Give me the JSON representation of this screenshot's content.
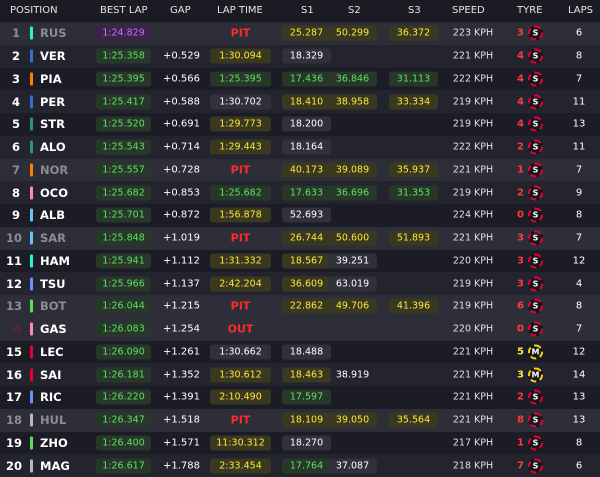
{
  "headers": {
    "position": "POSITION",
    "best_lap": "BEST LAP",
    "gap": "GAP",
    "lap_time": "LAP TIME",
    "s1": "S1",
    "s2": "S2",
    "s3": "S3",
    "speed": "SPEED",
    "tyre": "TYRE",
    "laps": "LAPS"
  },
  "colors": {
    "personal_best_green": "#5ee05e",
    "fastest_purple": "#c96cff",
    "improved_yellow": "#ffe63c",
    "pit_red": "#ff2a2a",
    "soft_tyre": "#e8002d",
    "medium_tyre": "#ffd200"
  },
  "rows": [
    {
      "pos": "1",
      "driver": "RUS",
      "team_color": "#27f4d2",
      "best": "1:24.829",
      "best_style": "fast",
      "gap": "",
      "lap": "PIT",
      "lap_style": "pit",
      "s1": "25.287",
      "s1_style": "yellow",
      "s2": "50.299",
      "s2_style": "yellow",
      "s3": "36.372",
      "s3_style": "yellow",
      "speed": "223 KPH",
      "tyre_age": "3",
      "tyre": "S",
      "tyre_type": "soft",
      "laps": "6",
      "dim": true
    },
    {
      "pos": "2",
      "driver": "VER",
      "team_color": "#3671c6",
      "best": "1:25.358",
      "best_style": "green",
      "gap": "+0.529",
      "lap": "1:30.094",
      "lap_style": "pb",
      "s1": "18.329",
      "s1_style": "white",
      "s2": "",
      "s2_style": "blank",
      "s3": "",
      "s3_style": "blank",
      "speed": "221 KPH",
      "tyre_age": "4",
      "tyre": "S",
      "tyre_type": "soft",
      "laps": "8",
      "dim": false
    },
    {
      "pos": "3",
      "driver": "PIA",
      "team_color": "#ff8000",
      "best": "1:25.395",
      "best_style": "green",
      "gap": "+0.566",
      "lap": "1:25.395",
      "lap_style": "green",
      "s1": "17.436",
      "s1_style": "green",
      "s2": "36.846",
      "s2_style": "green",
      "s3": "31.113",
      "s3_style": "green",
      "speed": "222 KPH",
      "tyre_age": "4",
      "tyre": "S",
      "tyre_type": "soft",
      "laps": "7",
      "dim": false
    },
    {
      "pos": "4",
      "driver": "PER",
      "team_color": "#3671c6",
      "best": "1:25.417",
      "best_style": "green",
      "gap": "+0.588",
      "lap": "1:30.702",
      "lap_style": "white",
      "s1": "18.410",
      "s1_style": "yellow",
      "s2": "38.958",
      "s2_style": "yellow",
      "s3": "33.334",
      "s3_style": "yellow",
      "speed": "219 KPH",
      "tyre_age": "4",
      "tyre": "S",
      "tyre_type": "soft",
      "laps": "11",
      "dim": false
    },
    {
      "pos": "5",
      "driver": "STR",
      "team_color": "#229971",
      "best": "1:25.520",
      "best_style": "green",
      "gap": "+0.691",
      "lap": "1:29.773",
      "lap_style": "pb",
      "s1": "18.200",
      "s1_style": "white",
      "s2": "",
      "s2_style": "blank",
      "s3": "",
      "s3_style": "blank",
      "speed": "219 KPH",
      "tyre_age": "4",
      "tyre": "S",
      "tyre_type": "soft",
      "laps": "13",
      "dim": false
    },
    {
      "pos": "6",
      "driver": "ALO",
      "team_color": "#229971",
      "best": "1:25.543",
      "best_style": "green",
      "gap": "+0.714",
      "lap": "1:29.443",
      "lap_style": "pb",
      "s1": "18.164",
      "s1_style": "white",
      "s2": "",
      "s2_style": "blank",
      "s3": "",
      "s3_style": "blank",
      "speed": "222 KPH",
      "tyre_age": "2",
      "tyre": "S",
      "tyre_type": "soft",
      "laps": "11",
      "dim": false
    },
    {
      "pos": "7",
      "driver": "NOR",
      "team_color": "#ff8000",
      "best": "1:25.557",
      "best_style": "green",
      "gap": "+0.728",
      "lap": "PIT",
      "lap_style": "pit",
      "s1": "40.173",
      "s1_style": "yellow",
      "s2": "39.089",
      "s2_style": "yellow",
      "s3": "35.937",
      "s3_style": "yellow",
      "speed": "221 KPH",
      "tyre_age": "1",
      "tyre": "S",
      "tyre_type": "soft",
      "laps": "7",
      "dim": true
    },
    {
      "pos": "8",
      "driver": "OCO",
      "team_color": "#ff87bc",
      "best": "1:25.682",
      "best_style": "green",
      "gap": "+0.853",
      "lap": "1:25.682",
      "lap_style": "green",
      "s1": "17.633",
      "s1_style": "green",
      "s2": "36.696",
      "s2_style": "green",
      "s3": "31.353",
      "s3_style": "green",
      "speed": "219 KPH",
      "tyre_age": "2",
      "tyre": "S",
      "tyre_type": "soft",
      "laps": "9",
      "dim": false
    },
    {
      "pos": "9",
      "driver": "ALB",
      "team_color": "#64c4ff",
      "best": "1:25.701",
      "best_style": "green",
      "gap": "+0.872",
      "lap": "1:56.878",
      "lap_style": "pb",
      "s1": "52.693",
      "s1_style": "white",
      "s2": "",
      "s2_style": "blank",
      "s3": "",
      "s3_style": "blank",
      "speed": "224 KPH",
      "tyre_age": "0",
      "tyre": "S",
      "tyre_type": "soft",
      "laps": "8",
      "dim": false
    },
    {
      "pos": "10",
      "driver": "SAR",
      "team_color": "#64c4ff",
      "best": "1:25.848",
      "best_style": "green",
      "gap": "+1.019",
      "lap": "PIT",
      "lap_style": "pit",
      "s1": "26.744",
      "s1_style": "yellow",
      "s2": "50.600",
      "s2_style": "yellow",
      "s3": "51.893",
      "s3_style": "yellow",
      "speed": "221 KPH",
      "tyre_age": "3",
      "tyre": "S",
      "tyre_type": "soft",
      "laps": "7",
      "dim": true
    },
    {
      "pos": "11",
      "driver": "HAM",
      "team_color": "#27f4d2",
      "best": "1:25.941",
      "best_style": "green",
      "gap": "+1.112",
      "lap": "1:31.332",
      "lap_style": "pb",
      "s1": "18.567",
      "s1_style": "yellow",
      "s2": "39.251",
      "s2_style": "white",
      "s3": "",
      "s3_style": "blank",
      "speed": "220 KPH",
      "tyre_age": "3",
      "tyre": "S",
      "tyre_type": "soft",
      "laps": "12",
      "dim": false
    },
    {
      "pos": "12",
      "driver": "TSU",
      "team_color": "#6692ff",
      "best": "1:25.966",
      "best_style": "green",
      "gap": "+1.137",
      "lap": "2:42.204",
      "lap_style": "pb",
      "s1": "36.609",
      "s1_style": "yellow",
      "s2": "63.019",
      "s2_style": "white",
      "s3": "",
      "s3_style": "blank",
      "speed": "219 KPH",
      "tyre_age": "3",
      "tyre": "S",
      "tyre_type": "soft",
      "laps": "4",
      "dim": false
    },
    {
      "pos": "13",
      "driver": "BOT",
      "team_color": "#52e252",
      "best": "1:26.044",
      "best_style": "green",
      "gap": "+1.215",
      "lap": "PIT",
      "lap_style": "pit",
      "s1": "22.862",
      "s1_style": "yellow",
      "s2": "49.706",
      "s2_style": "yellow",
      "s3": "41.396",
      "s3_style": "yellow",
      "speed": "219 KPH",
      "tyre_age": "6",
      "tyre": "S",
      "tyre_type": "soft",
      "laps": "8",
      "dim": true
    },
    {
      "pos": "◁",
      "driver": "GAS",
      "team_color": "#ff87bc",
      "best": "1:26.083",
      "best_style": "green",
      "gap": "+1.254",
      "lap": "OUT",
      "lap_style": "pit",
      "s1": "",
      "s1_style": "blank",
      "s2": "",
      "s2_style": "blank",
      "s3": "",
      "s3_style": "blank",
      "speed": "220 KPH",
      "tyre_age": "0",
      "tyre": "S",
      "tyre_type": "soft",
      "laps": "7",
      "dim": false,
      "retired": true
    },
    {
      "pos": "15",
      "driver": "LEC",
      "team_color": "#e8002d",
      "best": "1:26.090",
      "best_style": "green",
      "gap": "+1.261",
      "lap": "1:30.662",
      "lap_style": "white",
      "s1": "18.488",
      "s1_style": "white",
      "s2": "",
      "s2_style": "blank",
      "s3": "",
      "s3_style": "blank",
      "speed": "221 KPH",
      "tyre_age": "5",
      "tyre": "M",
      "tyre_type": "medium",
      "laps": "12",
      "dim": false
    },
    {
      "pos": "16",
      "driver": "SAI",
      "team_color": "#e8002d",
      "best": "1:26.181",
      "best_style": "green",
      "gap": "+1.352",
      "lap": "1:30.612",
      "lap_style": "pb",
      "s1": "18.463",
      "s1_style": "yellow",
      "s2": "38.919",
      "s2_style": "blank",
      "s3": "",
      "s3_style": "blank",
      "speed": "221 KPH",
      "tyre_age": "3",
      "tyre": "M",
      "tyre_type": "medium",
      "laps": "14",
      "dim": false
    },
    {
      "pos": "17",
      "driver": "RIC",
      "team_color": "#6692ff",
      "best": "1:26.220",
      "best_style": "green",
      "gap": "+1.391",
      "lap": "2:10.490",
      "lap_style": "pb",
      "s1": "17.597",
      "s1_style": "green",
      "s2": "",
      "s2_style": "blank",
      "s3": "",
      "s3_style": "blank",
      "speed": "221 KPH",
      "tyre_age": "2",
      "tyre": "S",
      "tyre_type": "soft",
      "laps": "13",
      "dim": false
    },
    {
      "pos": "18",
      "driver": "HUL",
      "team_color": "#b6babd",
      "best": "1:26.347",
      "best_style": "green",
      "gap": "+1.518",
      "lap": "PIT",
      "lap_style": "pit",
      "s1": "18.109",
      "s1_style": "yellow",
      "s2": "39.050",
      "s2_style": "yellow",
      "s3": "35.564",
      "s3_style": "yellow",
      "speed": "221 KPH",
      "tyre_age": "8",
      "tyre": "S",
      "tyre_type": "soft",
      "laps": "13",
      "dim": true
    },
    {
      "pos": "19",
      "driver": "ZHO",
      "team_color": "#52e252",
      "best": "1:26.400",
      "best_style": "green",
      "gap": "+1.571",
      "lap": "11:30.312",
      "lap_style": "pb",
      "s1": "18.270",
      "s1_style": "white",
      "s2": "",
      "s2_style": "blank",
      "s3": "",
      "s3_style": "blank",
      "speed": "217 KPH",
      "tyre_age": "1",
      "tyre": "S",
      "tyre_type": "soft",
      "laps": "8",
      "dim": false
    },
    {
      "pos": "20",
      "driver": "MAG",
      "team_color": "#b6babd",
      "best": "1:26.617",
      "best_style": "green",
      "gap": "+1.788",
      "lap": "2:33.454",
      "lap_style": "pb",
      "s1": "17.764",
      "s1_style": "green",
      "s2": "37.087",
      "s2_style": "white",
      "s3": "",
      "s3_style": "blank",
      "speed": "218 KPH",
      "tyre_age": "7",
      "tyre": "S",
      "tyre_type": "soft",
      "laps": "6",
      "dim": false
    }
  ]
}
